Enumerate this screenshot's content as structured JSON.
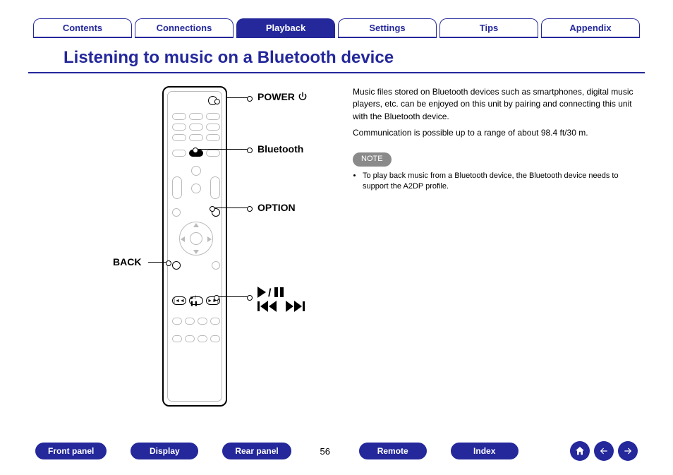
{
  "topnav": {
    "items": [
      {
        "label": "Contents",
        "active": false
      },
      {
        "label": "Connections",
        "active": false
      },
      {
        "label": "Playback",
        "active": true
      },
      {
        "label": "Settings",
        "active": false
      },
      {
        "label": "Tips",
        "active": false
      },
      {
        "label": "Appendix",
        "active": false
      }
    ]
  },
  "title": "Listening to music on a Bluetooth device",
  "callouts": {
    "power": "POWER",
    "bluetooth": "Bluetooth",
    "option": "OPTION",
    "back": "BACK",
    "transport_playpause": "▶/❚❚",
    "transport_skip": "◄◄ ►►"
  },
  "body": {
    "p1": "Music files stored on Bluetooth devices such as smartphones, digital music players, etc. can be enjoyed on this unit by pairing and connecting this unit with the Bluetooth device.",
    "p2": "Communication is possible up to a range of about 98.4 ft/30 m."
  },
  "note": {
    "badge": "NOTE",
    "items": [
      "To play back music from a Bluetooth device, the Bluetooth device needs to support the A2DP profile."
    ]
  },
  "bottomnav": {
    "front": "Front panel",
    "display": "Display",
    "rear": "Rear panel",
    "remote": "Remote",
    "index": "Index"
  },
  "page_number": "56"
}
